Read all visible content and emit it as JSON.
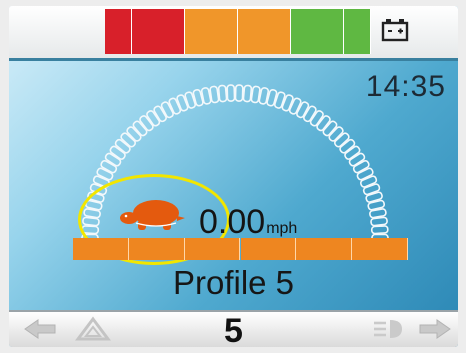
{
  "status": {
    "time": "14:35",
    "battery_icon": "battery-icon",
    "battery_colors": [
      "#d8202a",
      "#d8202a",
      "#d8202a",
      "#f0962a",
      "#f0962a",
      "#f0962a",
      "#f0962a",
      "#5fb842",
      "#5fb842",
      "#5fb842"
    ]
  },
  "drive": {
    "speed_value": "0.00",
    "speed_unit": "mph",
    "speed_mode_icon": "turtle-icon",
    "speed_bar_cells": 6,
    "speed_bar_filled": 6,
    "speed_bar_color": "#ee8620"
  },
  "profile": {
    "name": "Profile 5",
    "number": "5"
  },
  "nav": {
    "left_icons": [
      "arrow-left-icon",
      "hazard-icon"
    ],
    "right_icons": [
      "lights-icon",
      "arrow-right-icon"
    ]
  },
  "colors": {
    "highlight": "#f2e600",
    "turtle": "#e45a0e"
  }
}
